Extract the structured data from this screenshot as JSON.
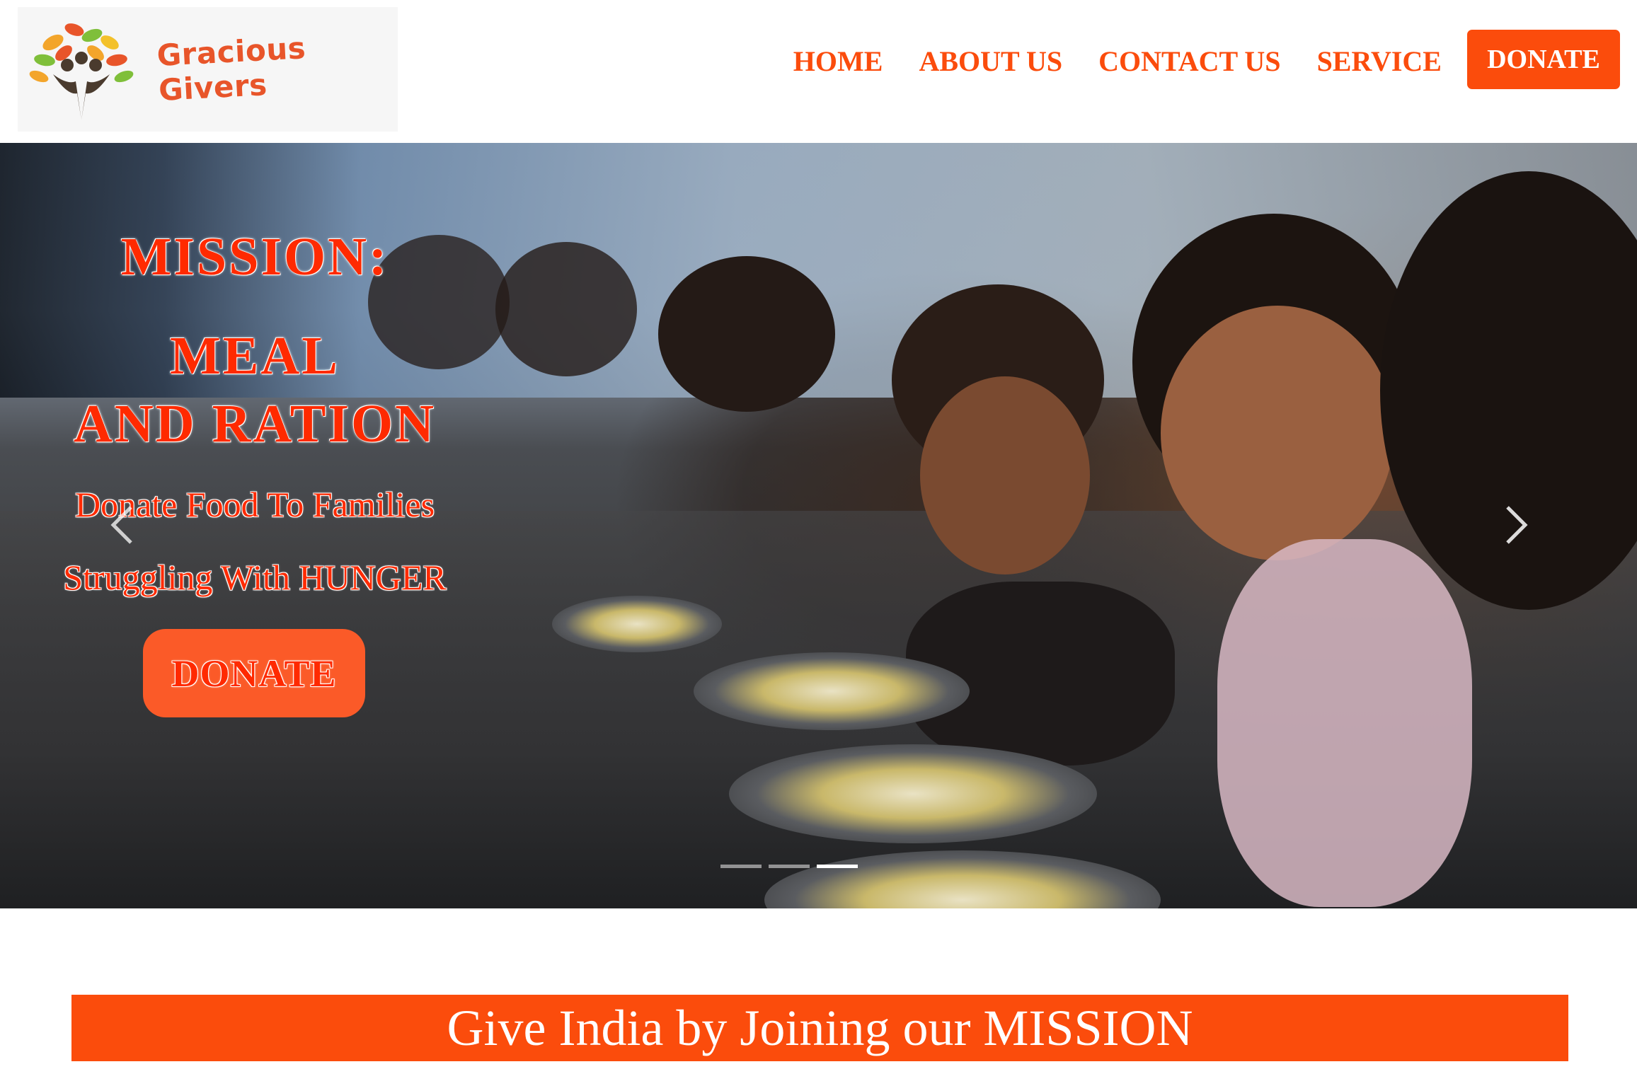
{
  "brand": {
    "name": "Gracious Givers"
  },
  "nav": {
    "items": [
      {
        "label": "HOME"
      },
      {
        "label": "ABOUT US"
      },
      {
        "label": "CONTACT US"
      },
      {
        "label": "SERVICE"
      }
    ],
    "donate_label": "DONATE"
  },
  "hero": {
    "title_line1": "MISSION:",
    "title_line2": "MEAL",
    "title_line3": "AND RATION",
    "subtitle_line1": "Donate Food To Families",
    "subtitle_line2": "Struggling With HUNGER",
    "donate_label": "DONATE",
    "prev_icon": "chevron-left-icon",
    "next_icon": "chevron-right-icon",
    "slides_total": 3,
    "active_slide": 3
  },
  "banner": {
    "text": "Give India by Joining our MISSION"
  },
  "colors": {
    "accent": "#fb4c0c",
    "hero_text": "#ff2a00",
    "button": "#fb5a28"
  }
}
